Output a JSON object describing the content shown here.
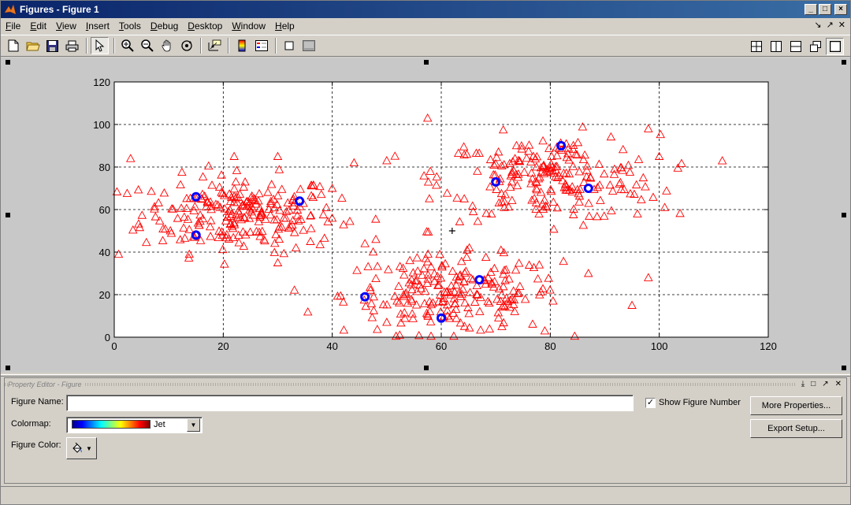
{
  "window": {
    "title": "Figures - Figure 1"
  },
  "menu": [
    {
      "label": "File",
      "u": "F",
      "rest": "ile"
    },
    {
      "label": "Edit",
      "u": "E",
      "rest": "dit"
    },
    {
      "label": "View",
      "u": "V",
      "rest": "iew"
    },
    {
      "label": "Insert",
      "u": "I",
      "rest": "nsert"
    },
    {
      "label": "Tools",
      "u": "T",
      "rest": "ools"
    },
    {
      "label": "Debug",
      "u": "D",
      "rest": "ebug"
    },
    {
      "label": "Desktop",
      "u": "D",
      "rest": "esktop"
    },
    {
      "label": "Window",
      "u": "W",
      "rest": "indow"
    },
    {
      "label": "Help",
      "u": "H",
      "rest": "elp"
    }
  ],
  "toolbar": {
    "icons": [
      "new-file-icon",
      "open-folder-icon",
      "save-icon",
      "print-icon",
      "select-arrow-icon",
      "zoom-in-icon",
      "zoom-out-icon",
      "pan-hand-icon",
      "rotate-3d-icon",
      "data-cursor-icon",
      "colorbar-icon",
      "legend-icon",
      "hide-plot-tools-icon",
      "show-plot-tools-icon"
    ],
    "layout_icons": [
      "tile-icon",
      "left-right-icon",
      "top-bottom-icon",
      "float-icon",
      "maximize-icon"
    ]
  },
  "property_editor": {
    "header": "Property Editor - Figure",
    "figure_name_label": "Figure Name:",
    "figure_name_value": "",
    "show_number_label": "Show Figure Number",
    "show_number_checked": true,
    "colormap_label": "Colormap:",
    "colormap_value": "Jet",
    "figure_color_label": "Figure Color:",
    "more_properties": "More Properties...",
    "export_setup": "Export Setup..."
  },
  "chart_data": {
    "type": "scatter",
    "xlim": [
      0,
      120
    ],
    "ylim": [
      0,
      120
    ],
    "xticks": [
      0,
      20,
      40,
      60,
      80,
      100,
      120
    ],
    "yticks": [
      0,
      20,
      40,
      60,
      80,
      100,
      120
    ],
    "grid": true,
    "series": [
      {
        "marker": "triangle",
        "color": "#ff0000",
        "clusters": [
          {
            "center": [
              23,
              58
            ],
            "spread": [
              9,
              9
            ],
            "count": 230
          },
          {
            "center": [
              62,
              20
            ],
            "spread": [
              10,
              9
            ],
            "count": 210
          },
          {
            "center": [
              80,
              75
            ],
            "spread": [
              10,
              10
            ],
            "count": 210
          }
        ],
        "extra_points": [
          [
            0.8,
            39
          ],
          [
            3,
            84
          ],
          [
            57.5,
            103
          ],
          [
            22,
            85
          ],
          [
            98,
            98
          ],
          [
            95,
            15
          ],
          [
            79,
            3
          ],
          [
            50,
            83
          ],
          [
            44,
            82
          ],
          [
            100,
            85
          ],
          [
            101,
            61
          ],
          [
            98,
            28
          ],
          [
            87,
            30
          ],
          [
            40,
            70
          ],
          [
            46,
            44
          ],
          [
            48,
            46
          ],
          [
            50,
            7
          ],
          [
            58,
            78
          ],
          [
            96,
            58
          ],
          [
            30,
            35
          ],
          [
            30,
            85
          ],
          [
            36,
            45
          ],
          [
            36,
            57
          ]
        ]
      },
      {
        "marker": "circle",
        "color": "#0000ff",
        "points": [
          [
            15,
            66
          ],
          [
            34,
            64
          ],
          [
            15,
            48
          ],
          [
            46,
            19
          ],
          [
            60,
            9
          ],
          [
            67,
            27
          ],
          [
            70,
            73
          ],
          [
            82,
            90
          ],
          [
            87,
            70
          ]
        ]
      },
      {
        "marker": "plus",
        "color": "#000000",
        "points": [
          [
            62,
            50
          ]
        ]
      }
    ]
  }
}
